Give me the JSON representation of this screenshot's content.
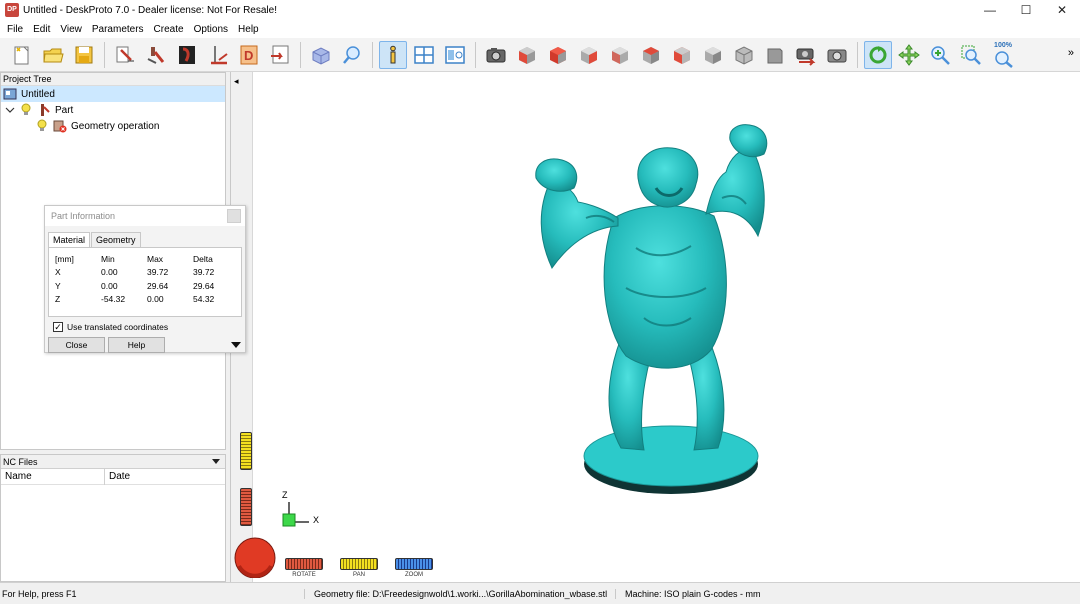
{
  "titlebar": {
    "app_icon_text": "DP",
    "title": "Untitled - DeskProto 7.0 - Dealer license: Not For Resale!",
    "minimize": "—",
    "maximize": "☐",
    "close": "✕"
  },
  "menu": [
    "File",
    "Edit",
    "View",
    "Parameters",
    "Create",
    "Options",
    "Help"
  ],
  "toolbar": {
    "zoom_label": "100%",
    "more": "»",
    "icons": [
      "new-file-icon",
      "open-folder-icon",
      "save-icon",
      "wizard-icon",
      "operation-icon",
      "part-icon",
      "toolpath-icon",
      "drawing-icon",
      "export-icon",
      "view-icon",
      "inspect-icon",
      "info-icon",
      "window-icon",
      "panel-icon",
      "camera-icon",
      "cube-front-icon",
      "cube-top-icon",
      "cube-left-icon",
      "cube-right-icon",
      "cube-back-icon",
      "cube-bottom-icon",
      "cube-iso-icon",
      "cube-view-icon",
      "cameras-icon",
      "camera-reset-icon",
      "rotate-tool-icon",
      "pan-tool-icon",
      "zoom-in-icon",
      "zoom-window-icon",
      "zoom-100-icon"
    ],
    "accent": "#3c9de0"
  },
  "project_tree": {
    "title": "Project Tree",
    "items": [
      {
        "label": "Untitled"
      },
      {
        "label": "Part"
      },
      {
        "label": "Geometry operation"
      }
    ]
  },
  "nc_files": {
    "title": "NC Files",
    "col_name": "Name",
    "col_date": "Date"
  },
  "part_info": {
    "title": "Part Information",
    "tabs": [
      "Material",
      "Geometry"
    ],
    "headers": [
      "[mm]",
      "Min",
      "Max",
      "Delta"
    ],
    "rows": [
      [
        "X",
        "0.00",
        "39.72",
        "39.72"
      ],
      [
        "Y",
        "0.00",
        "29.64",
        "29.64"
      ],
      [
        "Z",
        "-54.32",
        "0.00",
        "54.32"
      ]
    ],
    "checkbox_label": "Use translated coordinates",
    "checkbox_mark": "✓",
    "close_btn": "Close",
    "help_btn": "Help"
  },
  "viewport": {
    "collapse": "◂",
    "axis_z": "Z",
    "axis_x": "X",
    "model_color": "#2fc4c4",
    "dials": {
      "rotate": "ROTATE",
      "pan": "PAN",
      "zoom": "ZOOM"
    }
  },
  "status": {
    "help": "For Help, press F1",
    "geometry": "Geometry file: D:\\Freedesignwold\\1.worki...\\GorillaAbomination_wbase.stl",
    "machine": "Machine: ISO plain G-codes - mm"
  }
}
